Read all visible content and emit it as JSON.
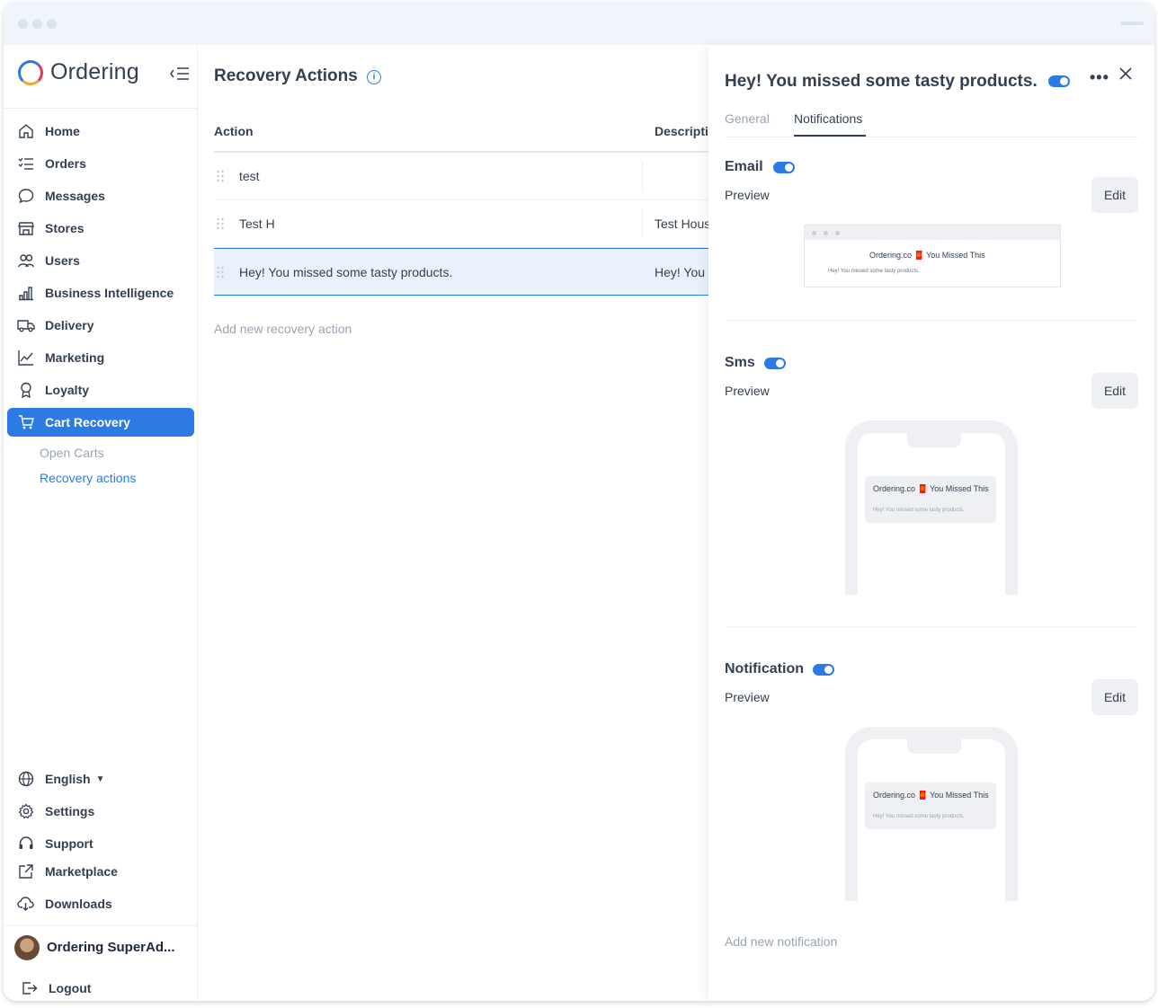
{
  "app": {
    "brand": "Ordering"
  },
  "sidebar": {
    "items": [
      {
        "label": "Home",
        "icon": "home-icon"
      },
      {
        "label": "Orders",
        "icon": "list-icon"
      },
      {
        "label": "Messages",
        "icon": "chat-icon"
      },
      {
        "label": "Stores",
        "icon": "store-icon"
      },
      {
        "label": "Users",
        "icon": "users-icon"
      },
      {
        "label": "Business Intelligence",
        "icon": "bar-chart-icon"
      },
      {
        "label": "Delivery",
        "icon": "truck-icon"
      },
      {
        "label": "Marketing",
        "icon": "line-chart-icon"
      },
      {
        "label": "Loyalty",
        "icon": "award-icon"
      },
      {
        "label": "Cart Recovery",
        "icon": "cart-icon"
      }
    ],
    "sub_items": [
      {
        "label": "Open Carts"
      },
      {
        "label": "Recovery actions"
      }
    ],
    "bottom_items": [
      {
        "label": "English",
        "icon": "globe-icon"
      },
      {
        "label": "Settings",
        "icon": "gear-icon"
      },
      {
        "label": "Support",
        "icon": "headset-icon"
      },
      {
        "label": "Marketplace",
        "icon": "external-link-icon"
      },
      {
        "label": "Downloads",
        "icon": "cloud-download-icon"
      }
    ],
    "user_name": "Ordering SuperAd...",
    "logout": "Logout"
  },
  "main": {
    "title": "Recovery Actions",
    "columns": [
      "Action",
      "Descripti"
    ],
    "rows": [
      {
        "action": "test",
        "description": ""
      },
      {
        "action": "Test H",
        "description": "Test Hous"
      },
      {
        "action": "Hey! You missed some tasty products.",
        "description": "Hey! You m"
      }
    ],
    "add_label": "Add new recovery action"
  },
  "panel": {
    "title": "Hey! You missed some tasty products.",
    "tabs": [
      "General",
      "Notifications"
    ],
    "active_tab": "Notifications",
    "sections": [
      {
        "title": "Email",
        "preview_label": "Preview",
        "edit_label": "Edit"
      },
      {
        "title": "Sms",
        "preview_label": "Preview",
        "edit_label": "Edit"
      },
      {
        "title": "Notification",
        "preview_label": "Preview",
        "edit_label": "Edit"
      }
    ],
    "email_preview": {
      "title": "Ordering.co 🧧 You Missed This",
      "body": "Hey! You missed some tasty products."
    },
    "sms_preview": {
      "title": "Ordering.co 🧧 You Missed This",
      "body": "Hey! You missed some tasty products."
    },
    "push_preview": {
      "title": "Ordering.co 🧧 You Missed This",
      "body": "Hey! You missed some tasty products."
    },
    "add_label": "Add new notification"
  },
  "colors": {
    "accent": "#2c7be5",
    "text": "#344050",
    "muted": "#9aa4b2"
  }
}
